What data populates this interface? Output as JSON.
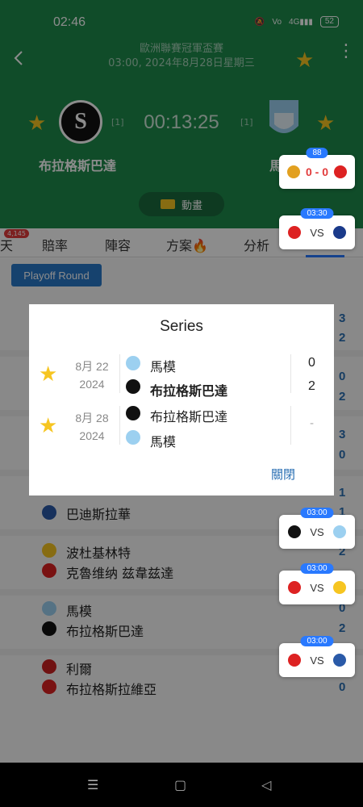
{
  "status": {
    "time": "02:46",
    "battery": "52"
  },
  "header": {
    "match_title": "歐洲聯賽冠軍盃賽",
    "match_datetime": "03:00, 2024年8月28日星期三",
    "home_team": "布拉格斯巴達",
    "away_team": "馬",
    "home_agg": "[1]",
    "away_agg": "[1]",
    "clock": "00:13:25",
    "animation_label": "動畫"
  },
  "tabs": [
    {
      "label": "天",
      "badge": "4,145"
    },
    {
      "label": "賠率"
    },
    {
      "label": "陣容"
    },
    {
      "label": "方案🔥"
    },
    {
      "label": "分析"
    }
  ],
  "content": {
    "playoff_button": "Playoff Round",
    "rows": [
      {
        "team": "巴迪斯拉華",
        "score": "1"
      },
      {
        "team": "波杜基林特",
        "score": "2"
      },
      {
        "team": "克魯维纳 兹韋兹達",
        "score": ""
      },
      {
        "team": "馬模",
        "score": "0"
      },
      {
        "team": "布拉格斯巴達",
        "score": "2"
      },
      {
        "team": "利爾",
        "score": ""
      },
      {
        "team": "布拉格斯拉維亞",
        "score": "0"
      }
    ],
    "right_scores": [
      "3",
      "2",
      "0",
      "2",
      "3",
      "0",
      "1",
      "1",
      "2"
    ]
  },
  "widgets": [
    {
      "tag": "88",
      "center": "0 - 0",
      "type": "score"
    },
    {
      "tag": "03:30",
      "center": "VS",
      "type": "vs"
    },
    {
      "tag": "03:00",
      "center": "VS",
      "type": "vs"
    },
    {
      "tag": "03:00",
      "center": "VS",
      "type": "vs"
    },
    {
      "tag": "03:00",
      "center": "VS",
      "type": "vs"
    }
  ],
  "dialog": {
    "title": "Series",
    "matches": [
      {
        "date": "8月 22",
        "year": "2024",
        "team1": "馬模",
        "team2": "布拉格斯巴達",
        "score1": "0",
        "score2": "2"
      },
      {
        "date": "8月 28",
        "year": "2024",
        "team1": "布拉格斯巴達",
        "team2": "馬模",
        "score_placeholder": "-"
      }
    ],
    "close_label": "關閉"
  }
}
